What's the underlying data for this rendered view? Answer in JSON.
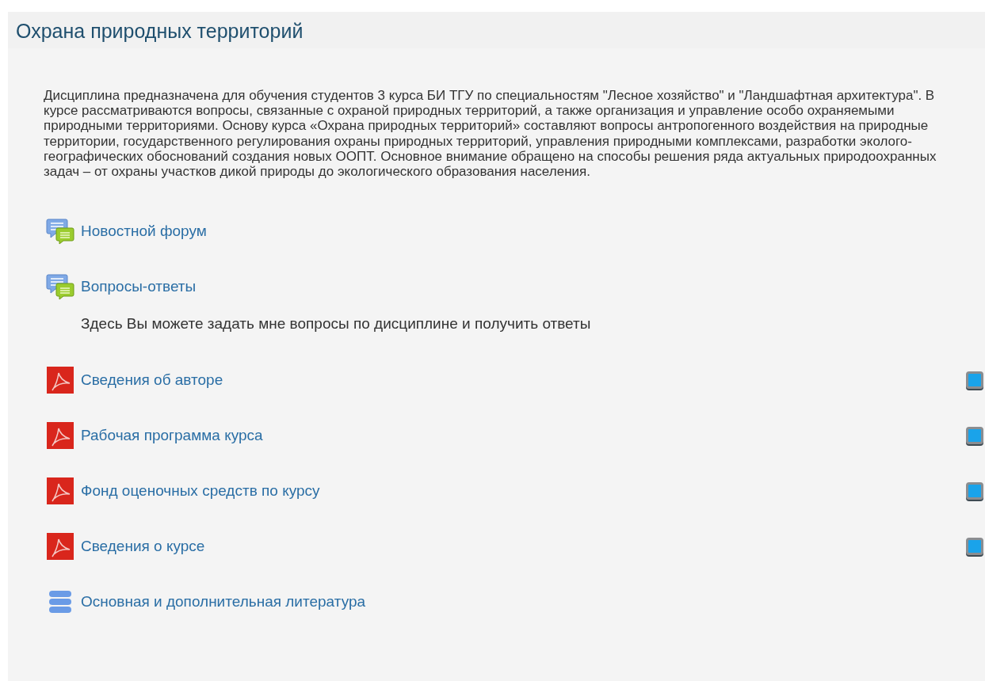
{
  "section": {
    "title": "Охрана природных территорий",
    "summary": "Дисциплина предназначена для обучения студентов 3 курса БИ ТГУ по специальностям \"Лесное хозяйство\" и \"Ландшафтная архитектура\". В курсе рассматриваются вопросы, связанные с охраной природных территорий, а также организация и управление особо охраняемыми природными территориями. Основу курса «Охрана природных территорий» составляют вопросы антропогенного воздействия на природные территории, государственного регулирования охраны природных территорий, управления природными комплексами, разработки эколого-географических обоснований создания новых ООПТ. Основное внимание обращено на способы решения ряда актуальных природоохранных задач – от охраны участков дикой природы до экологического образования населения.",
    "activities": [
      {
        "kind": "forum",
        "name": "Новостной форум"
      },
      {
        "kind": "forum",
        "name": "Вопросы-ответы",
        "description": "Здесь Вы можете задать мне вопросы по дисциплине и получить ответы"
      },
      {
        "kind": "pdf",
        "name": "Сведения об авторе",
        "completed": false
      },
      {
        "kind": "pdf",
        "name": "Рабочая программа курса",
        "completed": false
      },
      {
        "kind": "pdf",
        "name": "Фонд оценочных средств по курсу",
        "completed": false
      },
      {
        "kind": "pdf",
        "name": "Сведения о курсе",
        "completed": false
      },
      {
        "kind": "stack",
        "name": "Основная и дополнительная литература"
      }
    ]
  }
}
